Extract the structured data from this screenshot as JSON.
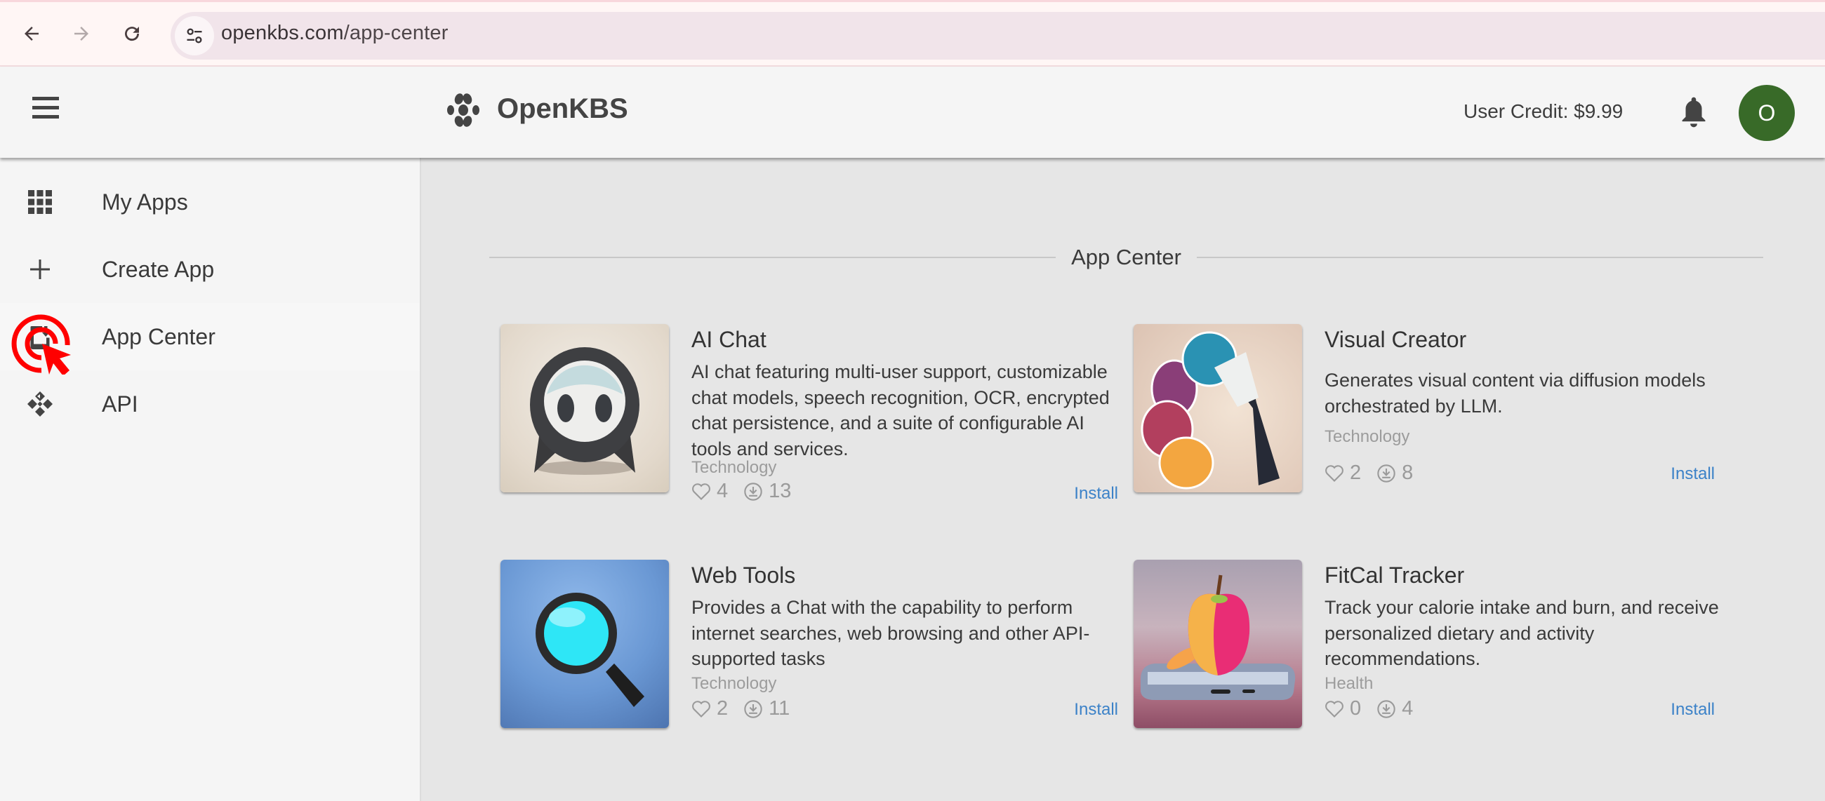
{
  "browser": {
    "url_domain": "openkbs.com",
    "url_path": "/app-center",
    "back_icon": "arrow-left-icon",
    "forward_icon": "arrow-right-icon",
    "reload_icon": "reload-icon",
    "site_info_icon": "tune-icon"
  },
  "header": {
    "brand": "OpenKBS",
    "credit": "User Credit: $9.99",
    "avatar_letter": "O",
    "avatar_color": "#386a28"
  },
  "sidebar": {
    "items": [
      {
        "label": "My Apps",
        "icon": "grid-icon",
        "active": false
      },
      {
        "label": "Create App",
        "icon": "plus-icon",
        "active": false
      },
      {
        "label": "App Center",
        "icon": "install-mobile-icon",
        "active": true
      },
      {
        "label": "API",
        "icon": "api-icon",
        "active": false
      }
    ]
  },
  "main": {
    "section_title": "App Center",
    "apps": [
      {
        "title": "AI Chat",
        "description": "AI chat featuring multi-user support, customizable chat models, speech recognition, OCR, encrypted chat persistence, and a suite of configurable AI tools and services.",
        "category": "Technology",
        "likes": "4",
        "installs": "13",
        "install_label": "Install",
        "image": "chat-bot-image"
      },
      {
        "title": "Visual Creator",
        "description": "Generates visual content via diffusion models orchestrated by LLM.",
        "category": "Technology",
        "likes": "2",
        "installs": "8",
        "install_label": "Install",
        "image": "paint-brush-image"
      },
      {
        "title": "Web Tools",
        "description": "Provides a Chat with the capability to perform internet searches, web browsing and other API-supported tasks",
        "category": "Technology",
        "likes": "2",
        "installs": "11",
        "install_label": "Install",
        "image": "magnifier-image"
      },
      {
        "title": "FitCal Tracker",
        "description": "Track your calorie intake and burn, and receive personalized dietary and activity recommendations.",
        "category": "Health",
        "likes": "0",
        "installs": "4",
        "install_label": "Install",
        "image": "apple-phone-image"
      }
    ]
  },
  "colors": {
    "accent_link": "#3c82c8",
    "click_marker": "#ff0000"
  }
}
